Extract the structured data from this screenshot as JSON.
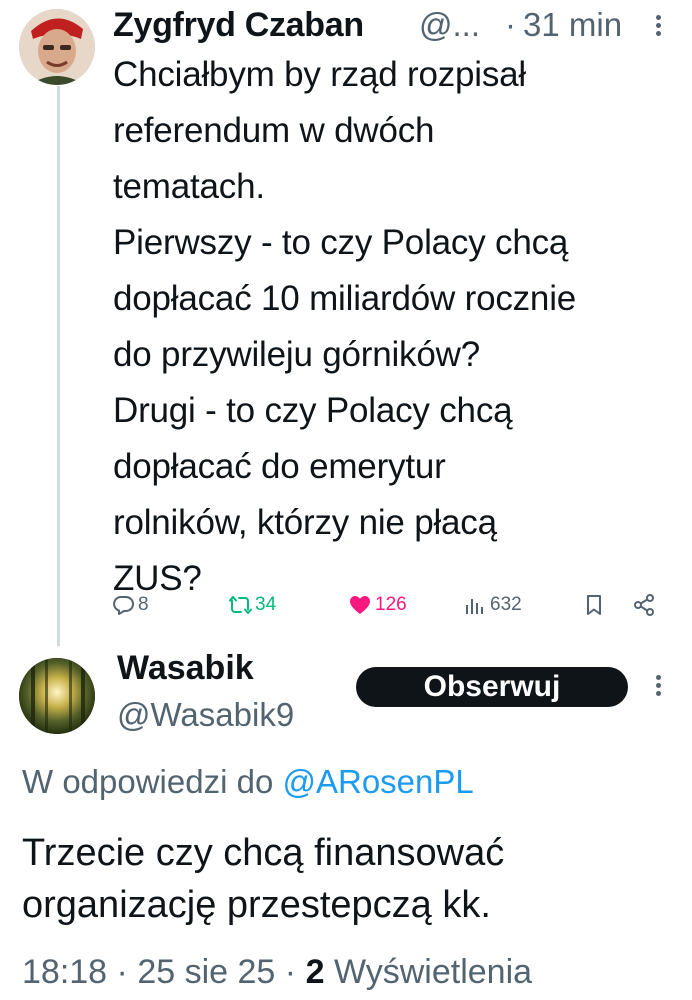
{
  "tweet1": {
    "author_name": "Zygfryd Czaban",
    "handle": "@...",
    "separator": "·",
    "time": "31 min",
    "text_lines": [
      "Chciałbym by rząd rozpisał",
      "referendum w dwóch",
      "tematach.",
      "Pierwszy - to czy Polacy chcą",
      "dopłacać 10 miliardów rocznie",
      "do przywileju górników?",
      "Drugi - to czy Polacy chcą",
      "dopłacać do emerytur",
      "rolników, którzy nie płacą",
      "ZUS?"
    ],
    "actions": {
      "replies": "8",
      "reposts": "34",
      "likes": "126",
      "views": "632"
    },
    "icons": [
      "reply-icon",
      "repost-icon",
      "like-icon",
      "views-icon",
      "bookmark-icon",
      "share-icon",
      "more-icon"
    ]
  },
  "tweet2": {
    "author_name": "Wasabik",
    "handle": "@Wasabik9",
    "follow_label": "Obserwuj",
    "reply_context": {
      "prefix": "W odpowiedzi do ",
      "mention": "@ARosenPL"
    },
    "text_lines": [
      "Trzecie czy chcą finansować",
      "organizację przestepczą kk."
    ],
    "meta": {
      "time": "18:18",
      "separator": "·",
      "date": "25 sie 25",
      "views_count": "2",
      "views_label": "Wyświetlenia"
    }
  },
  "colors": {
    "text": "#0f1419",
    "secondary": "#536471",
    "link": "#1d9bf0",
    "repost": "#00ba7c",
    "like": "#f91880",
    "thread_line": "#cfd9de",
    "follow_button": "#0f1419"
  }
}
